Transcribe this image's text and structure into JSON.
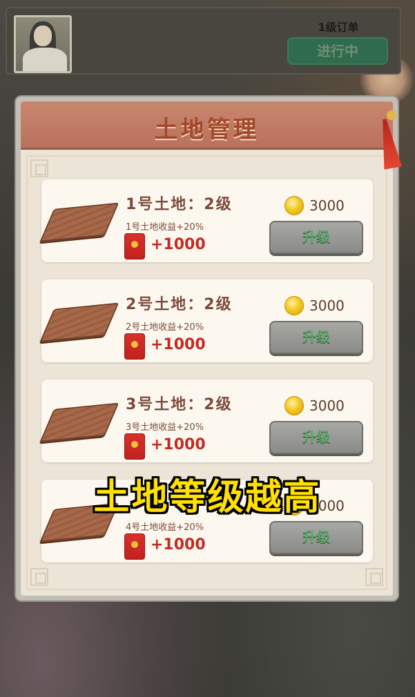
{
  "order": {
    "level_label": "1级订单",
    "status_label": "进行中"
  },
  "panel": {
    "title": "土地管理"
  },
  "lands": [
    {
      "name": "1号土地：2级",
      "bonus": "1号土地收益+20%",
      "reward": "+1000",
      "cost": "3000",
      "button_label": "升级"
    },
    {
      "name": "2号土地：2级",
      "bonus": "2号土地收益+20%",
      "reward": "+1000",
      "cost": "3000",
      "button_label": "升级"
    },
    {
      "name": "3号土地：2级",
      "bonus": "3号土地收益+20%",
      "reward": "+1000",
      "cost": "3000",
      "button_label": "升级"
    },
    {
      "name": "",
      "bonus": "4号土地收益+20%",
      "reward": "+1000",
      "cost": "3000",
      "button_label": "升级"
    }
  ],
  "caption": "土地等级越高",
  "colors": {
    "panel_header": "#b9725d",
    "title_text": "#a2472c",
    "reward_text": "#c22b22",
    "caption_text": "#ffe000",
    "button_text": "#5ea96c"
  },
  "icons": {
    "coin": "gold-coin-icon",
    "reward": "red-envelope-icon",
    "land": "land-plot-icon"
  }
}
